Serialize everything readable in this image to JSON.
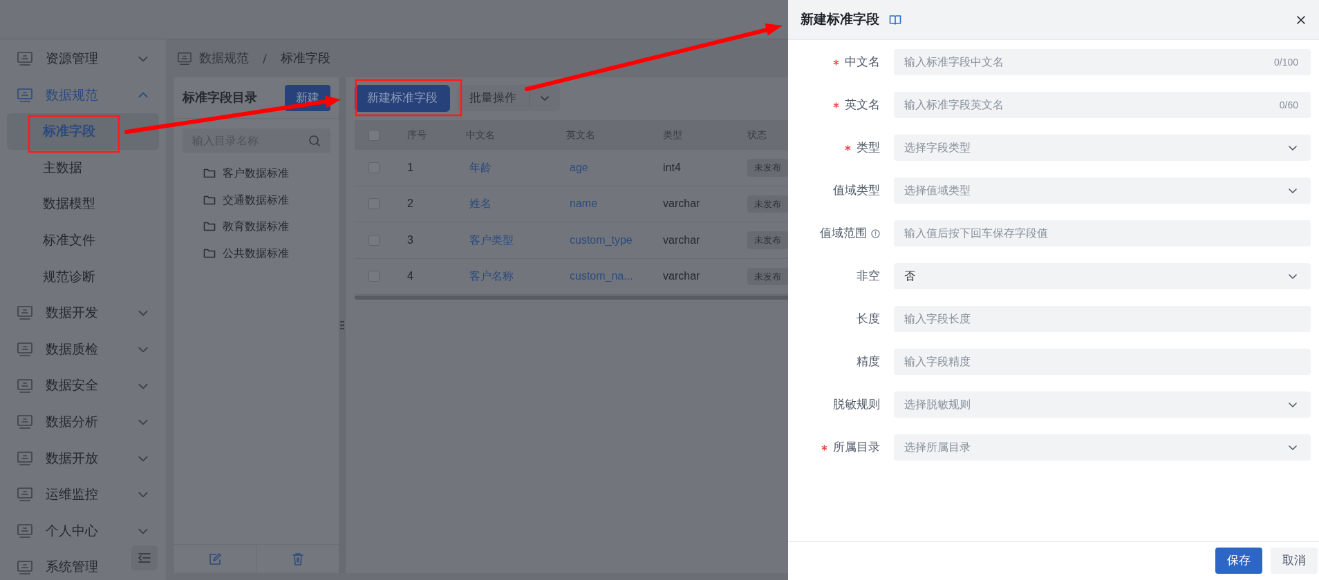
{
  "sidebar": {
    "items": [
      {
        "label": "资源管理",
        "expanded": false
      },
      {
        "label": "数据规范",
        "expanded": true,
        "children": [
          {
            "label": "标准字段",
            "selected": true
          },
          {
            "label": "主数据",
            "selected": false
          },
          {
            "label": "数据模型",
            "selected": false
          },
          {
            "label": "标准文件",
            "selected": false
          },
          {
            "label": "规范诊断",
            "selected": false
          }
        ]
      },
      {
        "label": "数据开发",
        "expanded": false
      },
      {
        "label": "数据质检",
        "expanded": false
      },
      {
        "label": "数据安全",
        "expanded": false
      },
      {
        "label": "数据分析",
        "expanded": false
      },
      {
        "label": "数据开放",
        "expanded": false
      },
      {
        "label": "运维监控",
        "expanded": false
      },
      {
        "label": "个人中心",
        "expanded": false
      },
      {
        "label": "系统管理",
        "expanded": false
      }
    ]
  },
  "breadcrumb": [
    "数据规范",
    "标准字段"
  ],
  "directory": {
    "title": "标准字段目录",
    "new_button": "新建",
    "search": {
      "placeholder": "输入目录名称"
    },
    "folders": [
      "客户数据标准",
      "交通数据标准",
      "教育数据标准",
      "公共数据标准"
    ]
  },
  "toolbar": {
    "primary_button": "新建标准字段",
    "batch_button": "批量操作"
  },
  "table": {
    "select_all_checked": false,
    "columns": [
      "序号",
      "中文名",
      "英文名",
      "类型",
      "状态"
    ],
    "rows": [
      {
        "checked": false,
        "cells": [
          "1",
          "年龄",
          "age",
          "int4",
          "未发布"
        ]
      },
      {
        "checked": false,
        "cells": [
          "2",
          "姓名",
          "name",
          "varchar",
          "未发布"
        ]
      },
      {
        "checked": false,
        "cells": [
          "3",
          "客户类型",
          "custom_type",
          "varchar",
          "未发布"
        ]
      },
      {
        "checked": false,
        "cells": [
          "4",
          "客户名称",
          "custom_na...",
          "varchar",
          "未发布"
        ]
      }
    ]
  },
  "drawer": {
    "title": "新建标准字段",
    "fields": [
      {
        "label": "中文名",
        "required": true,
        "kind": "input",
        "placeholder": "输入标准字段中文名",
        "counter": "0/100"
      },
      {
        "label": "英文名",
        "required": true,
        "kind": "input",
        "placeholder": "输入标准字段英文名",
        "counter": "0/60"
      },
      {
        "label": "类型",
        "required": true,
        "kind": "select",
        "placeholder": "选择字段类型"
      },
      {
        "label": "值域类型",
        "required": false,
        "kind": "select",
        "placeholder": "选择值域类型"
      },
      {
        "label": "值域范围",
        "required": false,
        "kind": "input",
        "placeholder": "输入值后按下回车保存字段值",
        "info_icon": true
      },
      {
        "label": "非空",
        "required": false,
        "kind": "select",
        "value": "否"
      },
      {
        "label": "长度",
        "required": false,
        "kind": "input",
        "placeholder": "输入字段长度"
      },
      {
        "label": "精度",
        "required": false,
        "kind": "input",
        "placeholder": "输入字段精度"
      },
      {
        "label": "脱敏规则",
        "required": false,
        "kind": "select",
        "placeholder": "选择脱敏规则"
      },
      {
        "label": "所属目录",
        "required": true,
        "kind": "select",
        "placeholder": "选择所属目录"
      }
    ],
    "buttons": [
      {
        "label": "保存",
        "primary": true
      },
      {
        "label": "取消",
        "primary": false
      }
    ]
  }
}
